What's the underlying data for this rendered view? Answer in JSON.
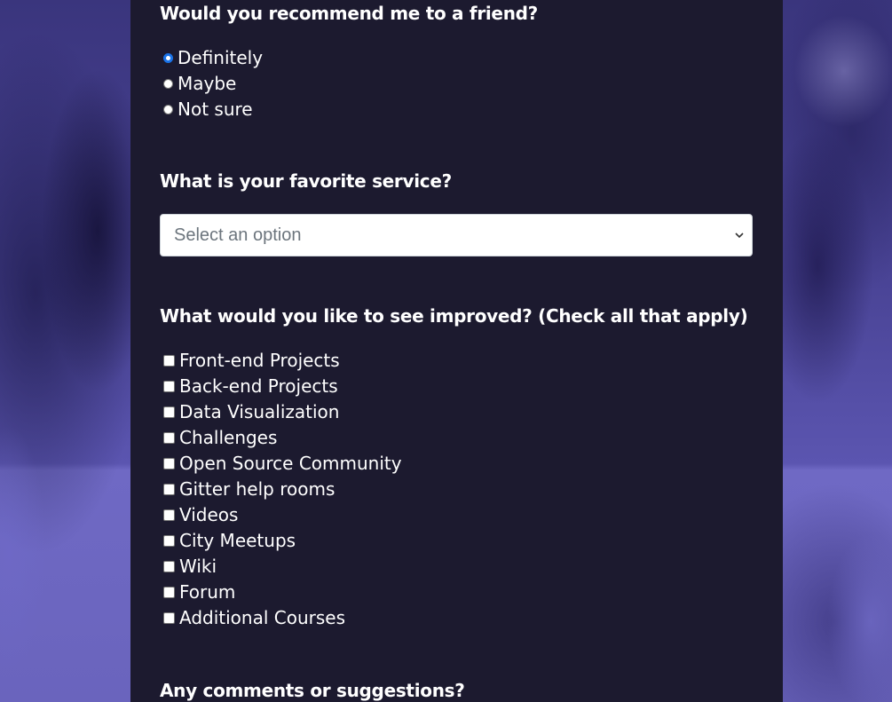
{
  "recommend": {
    "question": "Would you recommend me to a friend?",
    "options": [
      "Definitely",
      "Maybe",
      "Not sure"
    ],
    "selected": "Definitely"
  },
  "favorite": {
    "question": "What is your favorite service?",
    "placeholder": "Select an option"
  },
  "improve": {
    "question": "What would you like to see improved? (Check all that apply)",
    "options": [
      "Front-end Projects",
      "Back-end Projects",
      "Data Visualization",
      "Challenges",
      "Open Source Community",
      "Gitter help rooms",
      "Videos",
      "City Meetups",
      "Wiki",
      "Forum",
      "Additional Courses"
    ]
  },
  "comments": {
    "question": "Any comments or suggestions?"
  },
  "colors": {
    "panel": "#1c1a2f",
    "background": "#4e48a0",
    "radio_accent": "#1a73e8"
  }
}
